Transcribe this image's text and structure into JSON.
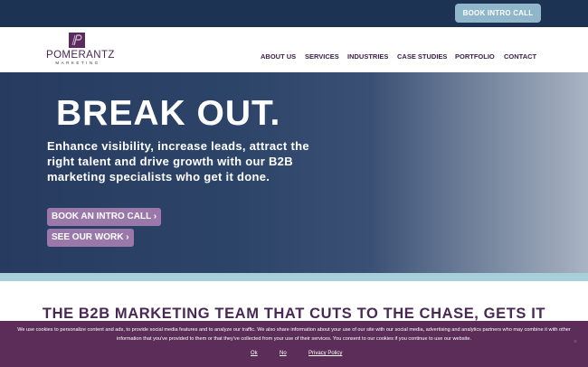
{
  "topbar": {
    "cta_label": "BOOK INTRO CALL"
  },
  "logo": {
    "name": "POMERANTZ",
    "tagline": "MARKETING"
  },
  "nav": {
    "items": [
      {
        "label": "ABOUT US"
      },
      {
        "label": "SERVICES"
      },
      {
        "label": "INDUSTRIES"
      },
      {
        "label": "CASE STUDIES"
      },
      {
        "label": "PORTFOLIO"
      },
      {
        "label": "CONTACT"
      }
    ]
  },
  "hero": {
    "title": "BREAK OUT.",
    "subtitle": "Enhance visibility, increase leads, attract the right talent and drive growth with our B2B marketing specialists who get it done.",
    "primary_button": "BOOK AN INTRO CALL",
    "secondary_button": "SEE OUR WORK",
    "chevron": "›"
  },
  "section": {
    "title": "THE B2B MARKETING TEAM THAT CUTS TO THE CHASE, GETS IT"
  },
  "cookie_banner": {
    "text": "We use cookies to personalize content and ads, to provide social media features and to analyze our traffic. We also share information about your use of our site with our social media, advertising and analytics partners who may combine it with other information that you've provided to them or that they've collected from your use of their services. You consent to our cookies if you continue to use our website.",
    "ok_label": "Ok",
    "no_label": "No",
    "privacy_label": "Privacy Policy",
    "close_glyph": "×"
  },
  "colors": {
    "topbar": "#1c3353",
    "cta_button": "#8fb6c9",
    "brand_purple": "#4a2856",
    "hero_button": "#9a79aa",
    "teal_band": "#a7cfda",
    "cookie_bg": "#5c2d58"
  },
  "icons": {
    "logo": "pomerantz-p-logo-icon",
    "button_arrow": "chevron-right-icon",
    "close": "close-icon"
  }
}
